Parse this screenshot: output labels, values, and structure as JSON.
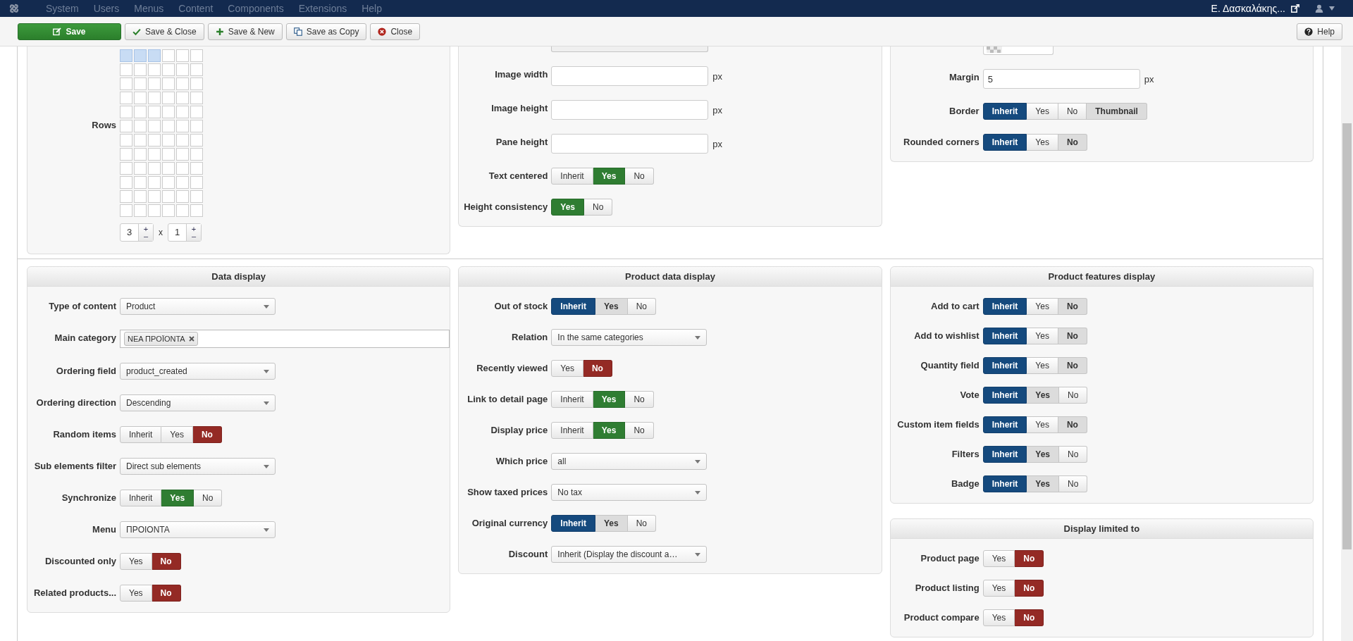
{
  "navbar": {
    "menu": [
      "System",
      "Users",
      "Menus",
      "Content",
      "Components",
      "Extensions",
      "Help"
    ],
    "user": "Ε. Δασκαλάκης..."
  },
  "toolbar": {
    "buttons": [
      {
        "label": "Save",
        "kind": "save"
      },
      {
        "label": "Save & Close",
        "kind": "save-close"
      },
      {
        "label": "Save & New",
        "kind": "save-new"
      },
      {
        "label": "Save as Copy",
        "kind": "save-copy"
      },
      {
        "label": "Close",
        "kind": "close"
      }
    ],
    "help": "Help"
  },
  "top_row": [
    {
      "fields": [
        {
          "kind": "grid",
          "label": "Rows",
          "cells": [
            [
              true,
              true,
              true,
              false,
              false,
              false
            ],
            [
              false,
              false,
              false,
              false,
              false,
              false
            ],
            [
              false,
              false,
              false,
              false,
              false,
              false
            ],
            [
              false,
              false,
              false,
              false,
              false,
              false
            ],
            [
              false,
              false,
              false,
              false,
              false,
              false
            ],
            [
              false,
              false,
              false,
              false,
              false,
              false
            ],
            [
              false,
              false,
              false,
              false,
              false,
              false
            ],
            [
              false,
              false,
              false,
              false,
              false,
              false
            ],
            [
              false,
              false,
              false,
              false,
              false,
              false
            ],
            [
              false,
              false,
              false,
              false,
              false,
              false
            ],
            [
              false,
              false,
              false,
              false,
              false,
              false
            ],
            [
              false,
              false,
              false,
              false,
              false,
              false
            ]
          ],
          "counters": [
            {
              "value": "3",
              "up": "+",
              "down": "–"
            },
            {
              "value": "1",
              "up": "+",
              "down": "–"
            }
          ],
          "separator": "x"
        }
      ]
    },
    {
      "fields": [
        {
          "kind": "cut-select"
        },
        {
          "kind": "text",
          "label": "Image width",
          "unit": "px"
        },
        {
          "kind": "text",
          "label": "Image height",
          "unit": "px"
        },
        {
          "kind": "text",
          "label": "Pane height",
          "unit": "px"
        },
        {
          "kind": "segmented",
          "label": "Text centered",
          "options": [
            {
              "label": "Inherit",
              "kind": "inherit",
              "selected": false,
              "default": false
            },
            {
              "label": "Yes",
              "kind": "yes",
              "selected": true,
              "default": false
            },
            {
              "label": "No",
              "kind": "no",
              "selected": false,
              "default": false
            }
          ]
        },
        {
          "kind": "segmented",
          "label": "Height consistency",
          "options": [
            {
              "label": "Yes",
              "kind": "yes",
              "selected": true,
              "default": false
            },
            {
              "label": "No",
              "kind": "no",
              "selected": false,
              "default": false
            }
          ]
        }
      ]
    },
    {
      "fields": [
        {
          "kind": "image"
        },
        {
          "kind": "text",
          "label": "Margin",
          "value": "5",
          "unit": "px"
        },
        {
          "kind": "segmented",
          "label": "Border",
          "options": [
            {
              "label": "Inherit",
              "kind": "inherit",
              "selected": true,
              "default": false
            },
            {
              "label": "Yes",
              "kind": "yes",
              "selected": false,
              "default": false
            },
            {
              "label": "No",
              "kind": "no",
              "selected": false,
              "default": false
            },
            {
              "label": "Thumbnail",
              "kind": "thumbnail",
              "selected": false,
              "default": true
            }
          ]
        },
        {
          "kind": "segmented",
          "label": "Rounded corners",
          "options": [
            {
              "label": "Inherit",
              "kind": "inherit",
              "selected": true,
              "default": false
            },
            {
              "label": "Yes",
              "kind": "yes",
              "selected": false,
              "default": false
            },
            {
              "label": "No",
              "kind": "no",
              "selected": false,
              "default": true
            }
          ]
        }
      ]
    }
  ],
  "bottom_row": [
    {
      "panels": [
        {
          "title": "Data display",
          "fields": [
            {
              "kind": "select",
              "label": "Type of content",
              "value": "Product"
            },
            {
              "kind": "tags",
              "label": "Main category",
              "tags": [
                "ΝΕΑ ΠΡΟΪΟΝΤΑ"
              ]
            },
            {
              "kind": "select",
              "label": "Ordering field",
              "value": "product_created"
            },
            {
              "kind": "select",
              "label": "Ordering direction",
              "value": "Descending"
            },
            {
              "kind": "segmented",
              "label": "Random items",
              "options": [
                {
                  "label": "Inherit",
                  "kind": "inherit",
                  "selected": false,
                  "default": false
                },
                {
                  "label": "Yes",
                  "kind": "yes",
                  "selected": false,
                  "default": false
                },
                {
                  "label": "No",
                  "kind": "no",
                  "selected": true,
                  "default": false
                }
              ]
            },
            {
              "kind": "select",
              "label": "Sub elements filter",
              "value": "Direct sub elements"
            },
            {
              "kind": "segmented",
              "label": "Synchronize",
              "options": [
                {
                  "label": "Inherit",
                  "kind": "inherit",
                  "selected": false,
                  "default": false
                },
                {
                  "label": "Yes",
                  "kind": "yes",
                  "selected": true,
                  "default": false
                },
                {
                  "label": "No",
                  "kind": "no",
                  "selected": false,
                  "default": false
                }
              ]
            },
            {
              "kind": "select",
              "label": "Menu",
              "value": "ΠΡΟΙΟΝΤΑ"
            },
            {
              "kind": "segmented",
              "label": "Discounted only",
              "options": [
                {
                  "label": "Yes",
                  "kind": "yes",
                  "selected": false,
                  "default": false
                },
                {
                  "label": "No",
                  "kind": "no",
                  "selected": true,
                  "default": false
                }
              ]
            },
            {
              "kind": "segmented",
              "label": "Related products...",
              "options": [
                {
                  "label": "Yes",
                  "kind": "yes",
                  "selected": false,
                  "default": false
                },
                {
                  "label": "No",
                  "kind": "no",
                  "selected": true,
                  "default": false
                }
              ]
            }
          ]
        }
      ]
    },
    {
      "panels": [
        {
          "title": "Product data display",
          "fields": [
            {
              "kind": "segmented",
              "label": "Out of stock",
              "options": [
                {
                  "label": "Inherit",
                  "kind": "inherit",
                  "selected": true,
                  "default": false
                },
                {
                  "label": "Yes",
                  "kind": "yes",
                  "selected": false,
                  "default": true
                },
                {
                  "label": "No",
                  "kind": "no",
                  "selected": false,
                  "default": false
                }
              ]
            },
            {
              "kind": "select",
              "label": "Relation",
              "value": "In the same categories"
            },
            {
              "kind": "segmented",
              "label": "Recently viewed",
              "options": [
                {
                  "label": "Yes",
                  "kind": "yes",
                  "selected": false,
                  "default": false
                },
                {
                  "label": "No",
                  "kind": "no",
                  "selected": true,
                  "default": false
                }
              ]
            },
            {
              "kind": "segmented",
              "label": "Link to detail page",
              "options": [
                {
                  "label": "Inherit",
                  "kind": "inherit",
                  "selected": false,
                  "default": false
                },
                {
                  "label": "Yes",
                  "kind": "yes",
                  "selected": true,
                  "default": false
                },
                {
                  "label": "No",
                  "kind": "no",
                  "selected": false,
                  "default": false
                }
              ]
            },
            {
              "kind": "segmented",
              "label": "Display price",
              "options": [
                {
                  "label": "Inherit",
                  "kind": "inherit",
                  "selected": false,
                  "default": false
                },
                {
                  "label": "Yes",
                  "kind": "yes",
                  "selected": true,
                  "default": false
                },
                {
                  "label": "No",
                  "kind": "no",
                  "selected": false,
                  "default": false
                }
              ]
            },
            {
              "kind": "select",
              "label": "Which price",
              "value": "all"
            },
            {
              "kind": "select",
              "label": "Show taxed prices",
              "value": "No tax"
            },
            {
              "kind": "segmented",
              "label": "Original currency",
              "options": [
                {
                  "label": "Inherit",
                  "kind": "inherit",
                  "selected": true,
                  "default": false
                },
                {
                  "label": "Yes",
                  "kind": "yes",
                  "selected": false,
                  "default": true
                },
                {
                  "label": "No",
                  "kind": "no",
                  "selected": false,
                  "default": false
                }
              ]
            },
            {
              "kind": "select",
              "label": "Discount",
              "value": "Inherit (Display the discount a…"
            }
          ]
        }
      ]
    },
    {
      "panels": [
        {
          "title": "Product features display",
          "fields": [
            {
              "kind": "segmented",
              "label": "Add to cart",
              "options": [
                {
                  "label": "Inherit",
                  "kind": "inherit",
                  "selected": true,
                  "default": false
                },
                {
                  "label": "Yes",
                  "kind": "yes",
                  "selected": false,
                  "default": false
                },
                {
                  "label": "No",
                  "kind": "no",
                  "selected": false,
                  "default": true
                }
              ]
            },
            {
              "kind": "segmented",
              "label": "Add to wishlist",
              "options": [
                {
                  "label": "Inherit",
                  "kind": "inherit",
                  "selected": true,
                  "default": false
                },
                {
                  "label": "Yes",
                  "kind": "yes",
                  "selected": false,
                  "default": false
                },
                {
                  "label": "No",
                  "kind": "no",
                  "selected": false,
                  "default": true
                }
              ]
            },
            {
              "kind": "segmented",
              "label": "Quantity field",
              "options": [
                {
                  "label": "Inherit",
                  "kind": "inherit",
                  "selected": true,
                  "default": false
                },
                {
                  "label": "Yes",
                  "kind": "yes",
                  "selected": false,
                  "default": false
                },
                {
                  "label": "No",
                  "kind": "no",
                  "selected": false,
                  "default": true
                }
              ]
            },
            {
              "kind": "segmented",
              "label": "Vote",
              "options": [
                {
                  "label": "Inherit",
                  "kind": "inherit",
                  "selected": true,
                  "default": false
                },
                {
                  "label": "Yes",
                  "kind": "yes",
                  "selected": false,
                  "default": true
                },
                {
                  "label": "No",
                  "kind": "no",
                  "selected": false,
                  "default": false
                }
              ]
            },
            {
              "kind": "segmented",
              "label": "Custom item fields",
              "options": [
                {
                  "label": "Inherit",
                  "kind": "inherit",
                  "selected": true,
                  "default": false
                },
                {
                  "label": "Yes",
                  "kind": "yes",
                  "selected": false,
                  "default": false
                },
                {
                  "label": "No",
                  "kind": "no",
                  "selected": false,
                  "default": true
                }
              ]
            },
            {
              "kind": "segmented",
              "label": "Filters",
              "options": [
                {
                  "label": "Inherit",
                  "kind": "inherit",
                  "selected": true,
                  "default": false
                },
                {
                  "label": "Yes",
                  "kind": "yes",
                  "selected": false,
                  "default": true
                },
                {
                  "label": "No",
                  "kind": "no",
                  "selected": false,
                  "default": false
                }
              ]
            },
            {
              "kind": "segmented",
              "label": "Badge",
              "options": [
                {
                  "label": "Inherit",
                  "kind": "inherit",
                  "selected": true,
                  "default": false
                },
                {
                  "label": "Yes",
                  "kind": "yes",
                  "selected": false,
                  "default": true
                },
                {
                  "label": "No",
                  "kind": "no",
                  "selected": false,
                  "default": false
                }
              ]
            }
          ]
        },
        {
          "title": "Display limited to",
          "fields": [
            {
              "kind": "segmented",
              "label": "Product page",
              "options": [
                {
                  "label": "Yes",
                  "kind": "yes",
                  "selected": false,
                  "default": false
                },
                {
                  "label": "No",
                  "kind": "no",
                  "selected": true,
                  "default": false
                }
              ]
            },
            {
              "kind": "segmented",
              "label": "Product listing",
              "options": [
                {
                  "label": "Yes",
                  "kind": "yes",
                  "selected": false,
                  "default": false
                },
                {
                  "label": "No",
                  "kind": "no",
                  "selected": true,
                  "default": false
                }
              ]
            },
            {
              "kind": "segmented",
              "label": "Product compare",
              "options": [
                {
                  "label": "Yes",
                  "kind": "yes",
                  "selected": false,
                  "default": false
                },
                {
                  "label": "No",
                  "kind": "no",
                  "selected": true,
                  "default": false
                }
              ]
            }
          ]
        }
      ]
    }
  ]
}
